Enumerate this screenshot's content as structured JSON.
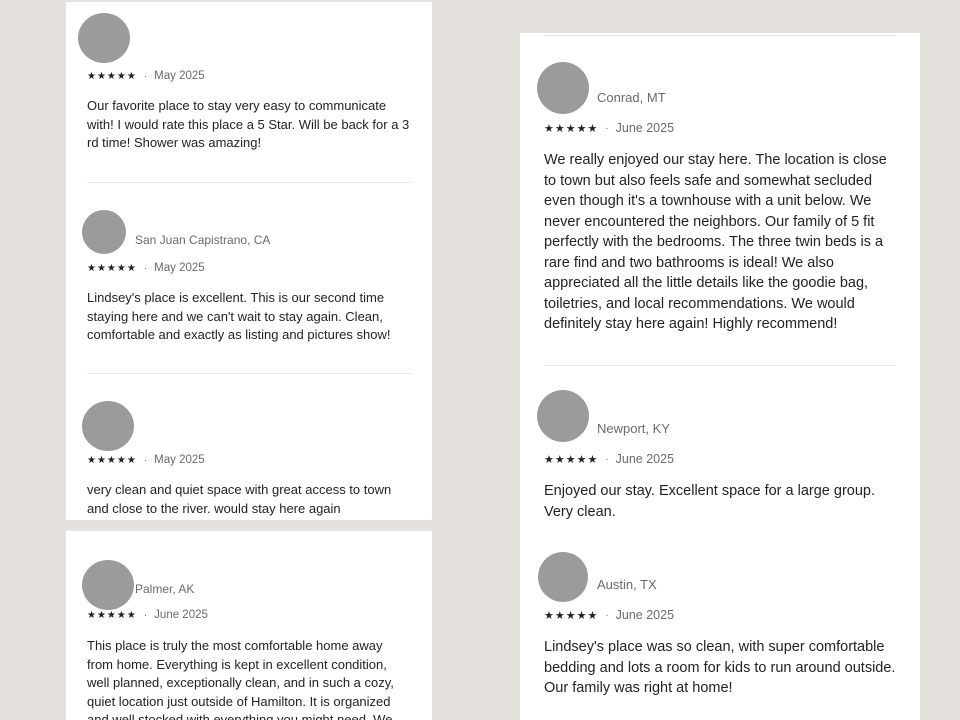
{
  "colors": {
    "background": "#e4e1dc",
    "card": "#ffffff",
    "avatar": "#9b9b9b",
    "text": "#222222",
    "muted": "#6a6a6a"
  },
  "icons": {
    "rating": "star-icon"
  },
  "reviews": [
    {
      "location": "",
      "stars": "★★★★★",
      "sep": "·",
      "date": "May 2025",
      "text": "Our favorite place to stay very easy to communicate with! I would rate this place a 5 Star. Will be back for a 3 rd time! Shower was amazing!"
    },
    {
      "location": "San Juan Capistrano, CA",
      "stars": "★★★★★",
      "sep": "·",
      "date": "May 2025",
      "text": "Lindsey's place is excellent. This is our second time staying here and we can't wait to stay again. Clean, comfortable and exactly as listing and pictures show!"
    },
    {
      "location": "",
      "stars": "★★★★★",
      "sep": "·",
      "date": "May 2025",
      "text": "very clean and quiet space with great access to town and close to the river. would stay here again"
    },
    {
      "location": "Palmer, AK",
      "stars": "★★★★★",
      "sep": "·",
      "date": "June 2025",
      "text": "This place is truly the most comfortable home away from home. Everything is kept in excellent condition, well planned, exceptionally clean, and in such a cozy, quiet location just outside of Hamilton. It is organized and well stocked with everything you might need. We"
    },
    {
      "location": "Conrad, MT",
      "stars": "★★★★★",
      "sep": "·",
      "date": "June 2025",
      "text": "We really enjoyed our stay here. The location is close to town but also feels safe and somewhat secluded even though it's a townhouse with a unit below. We never encountered the neighbors. Our family of 5 fit perfectly with the bedrooms. The three twin beds is a rare find and two bathrooms is ideal! We also appreciated all the little details like the goodie bag, toiletries, and local recommendations. We would definitely stay here again! Highly recommend!"
    },
    {
      "location": "Newport, KY",
      "stars": "★★★★★",
      "sep": "·",
      "date": "June 2025",
      "text": "Enjoyed our stay. Excellent space for a large group. Very clean."
    },
    {
      "location": "Austin, TX",
      "stars": "★★★★★",
      "sep": "·",
      "date": "June 2025",
      "text": "Lindsey's place was so clean, with super comfortable bedding and lots a room for kids to run around outside. Our family was right at home!"
    }
  ]
}
